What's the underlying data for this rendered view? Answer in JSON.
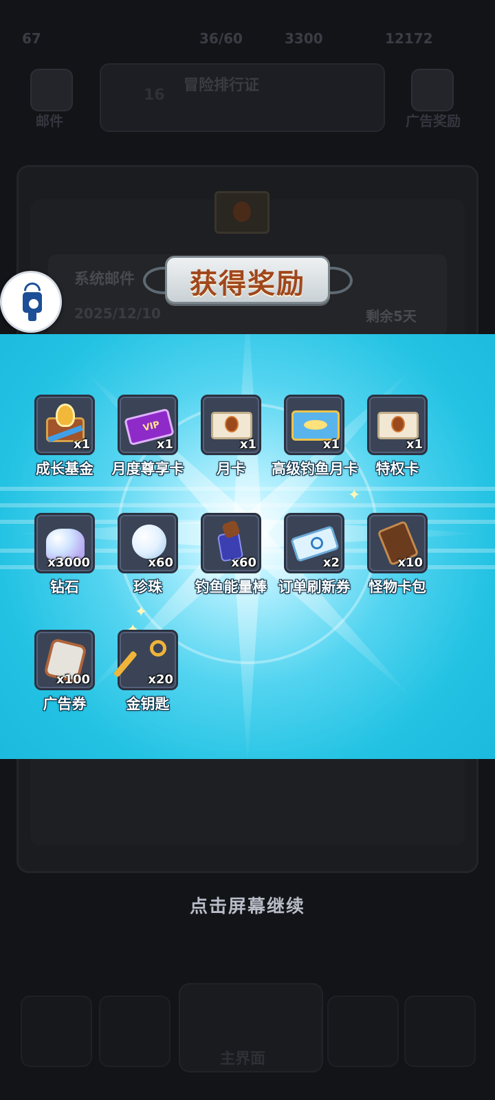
{
  "status_bar": {
    "time": "67",
    "stamina": "36/60",
    "coins": "3300",
    "gems": "12172"
  },
  "background": {
    "mail_button_label": "邮件",
    "ad_reward_label": "广告奖励",
    "banner_title": "冒险排行证",
    "banner_level": "16",
    "mail_card": {
      "title": "系统邮件",
      "date": "2025/12/10",
      "remaining": "剩余5天"
    },
    "nav_center_label": "主界面"
  },
  "reward_title": "获得奖励",
  "rewards": [
    {
      "name": "成长基金",
      "qty": "x1",
      "icon": "growth-fund-chest-icon"
    },
    {
      "name": "月度尊享卡",
      "qty": "x1",
      "icon": "vip-ticket-icon"
    },
    {
      "name": "月卡",
      "qty": "x1",
      "icon": "monthly-card-envelope-icon"
    },
    {
      "name": "高级钓鱼月卡",
      "qty": "x1",
      "icon": "fishing-card-icon"
    },
    {
      "name": "特权卡",
      "qty": "x1",
      "icon": "privilege-card-envelope-icon"
    },
    {
      "name": "钻石",
      "qty": "x3000",
      "icon": "diamond-pile-icon"
    },
    {
      "name": "珍珠",
      "qty": "x60",
      "icon": "pearl-icon"
    },
    {
      "name": "钓鱼能量棒",
      "qty": "x60",
      "icon": "energy-bar-icon"
    },
    {
      "name": "订单刷新券",
      "qty": "x2",
      "icon": "refresh-ticket-icon"
    },
    {
      "name": "怪物卡包",
      "qty": "x10",
      "icon": "monster-card-pack-icon"
    },
    {
      "name": "广告券",
      "qty": "x100",
      "icon": "ad-voucher-icon"
    },
    {
      "name": "金钥匙",
      "qty": "x20",
      "icon": "golden-key-icon"
    }
  ],
  "continue_hint": "点击屏幕继续"
}
